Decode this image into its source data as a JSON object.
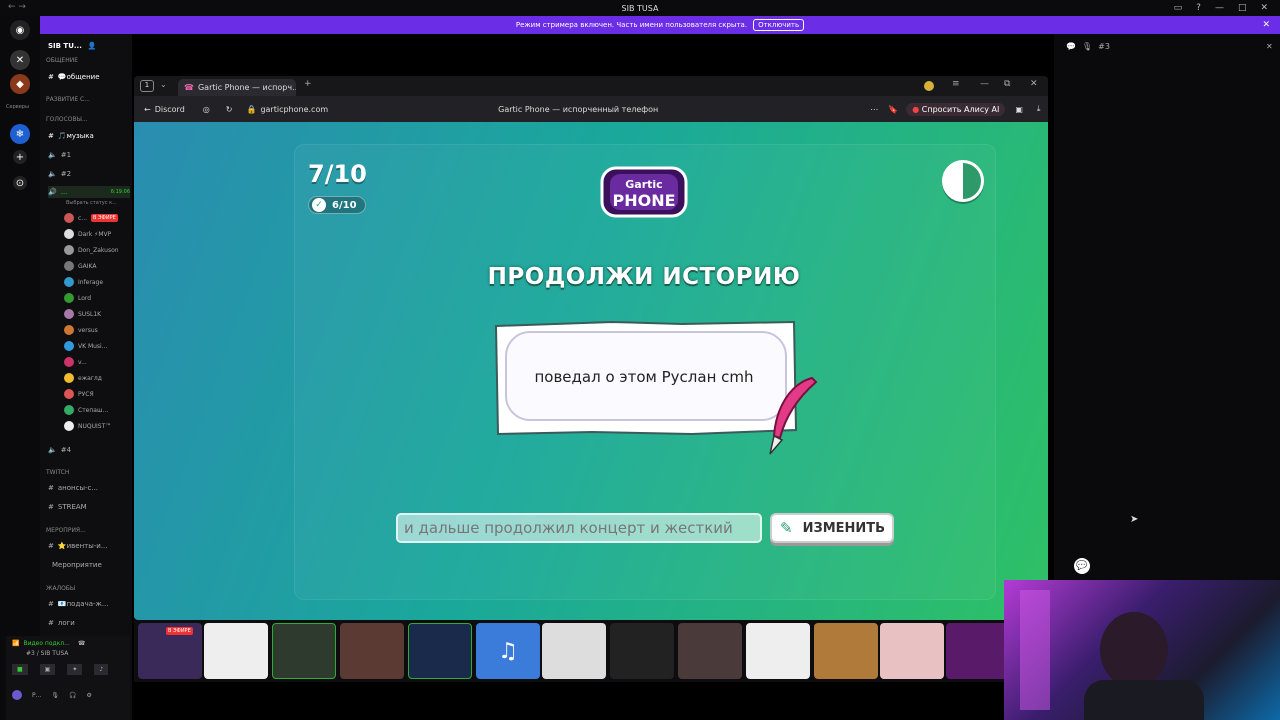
{
  "window": {
    "title": "SIB TUSA"
  },
  "banner": {
    "text": "Режим стримера включен. Часть имени пользователя скрыта.",
    "button": "Отключить"
  },
  "rail": {
    "label": "Серверы"
  },
  "sidebar": {
    "server_name": "SIB TU...",
    "categories": {
      "c1": "ОБЩЕНИЕ",
      "c2": "РАЗВИТИЕ С...",
      "c3": "ГОЛОСОВЫ...",
      "c4": "TWITCH",
      "c5": "МЕРОПРИЯ...",
      "c6": "ЖАЛОБЫ"
    },
    "channels": {
      "general": "💬общение",
      "music": "🎵музыка",
      "v1": "#1",
      "v2": "#2",
      "v3": "...",
      "v3_time": "6:19:06",
      "v3_status": "Выбрать статус к...",
      "v4": "#4",
      "announce": "анонсы-с...",
      "stream": "STREAM",
      "events": "⭐ивенты-и...",
      "event": "Мероприятие",
      "report": "📧подача-ж...",
      "logs": "логи"
    },
    "users": [
      {
        "name": "с...",
        "badge": "В ЭФИРЕ"
      },
      {
        "name": "Dark ⚡MVP"
      },
      {
        "name": "Don_Zakuson"
      },
      {
        "name": "GAIKA"
      },
      {
        "name": "Inferage"
      },
      {
        "name": "Lord"
      },
      {
        "name": "SUSL1K"
      },
      {
        "name": "versus"
      },
      {
        "name": "VK Musi..."
      },
      {
        "name": "v..."
      },
      {
        "name": "ежаглд"
      },
      {
        "name": "РУСЯ"
      },
      {
        "name": "Степаш..."
      },
      {
        "name": "NUQUIST™"
      }
    ],
    "voice_panel": {
      "status": "Видео подкл...",
      "channel": "#3 / SIB TUSA",
      "user": "Р..."
    }
  },
  "browser": {
    "tab_count": "1",
    "tab_title": "Gartic Phone — испорч...",
    "back_label": "Discord",
    "url": "garticphone.com",
    "page_title": "Gartic Phone — испорченный телефон",
    "alice": "Спросить Алису AI"
  },
  "game": {
    "round": "7/10",
    "done": "6/10",
    "logo_top": "Gartic",
    "logo_bottom": "PHONE",
    "heading": "ПРОДОЛЖИ ИСТОРИЮ",
    "prompt": "поведал о этом Руслан cmh",
    "answer": "и дальше продолжил концерт и жесткий",
    "edit_button": "ИЗМЕНИТЬ"
  },
  "strip": {
    "live_badge": "В ЭФИРЕ"
  },
  "right_panel": {
    "channel": "#3"
  },
  "colors": {
    "accent": "#6b2ee6",
    "game_start": "#2a8db0",
    "game_end": "#2fc066"
  }
}
